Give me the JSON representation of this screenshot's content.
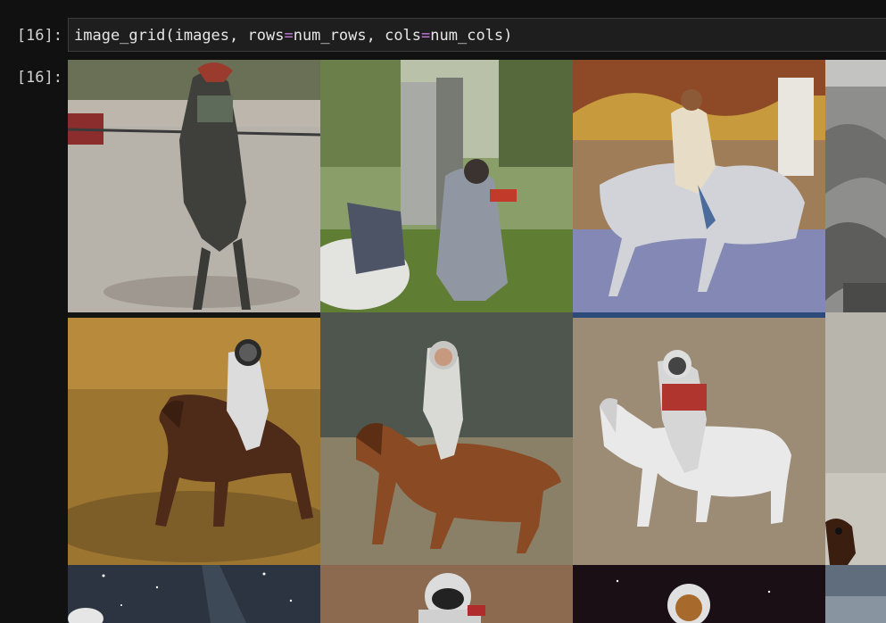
{
  "cell": {
    "input_prompt": "[16]:",
    "output_prompt": "[16]:",
    "code": {
      "fn": "image_grid",
      "open": "(",
      "arg1": "images, ",
      "kw1": "rows",
      "eq": "=",
      "val1": "num_rows",
      "sep": ", ",
      "kw2": "cols",
      "val2": "num_cols",
      "close": ")"
    }
  },
  "output": {
    "grid": {
      "tiles": [
        {
          "row": 0,
          "col": 0,
          "icon": "horse-creature-on-concrete"
        },
        {
          "row": 0,
          "col": 1,
          "icon": "astronaut-collage-forest"
        },
        {
          "row": 0,
          "col": 2,
          "icon": "woman-riding-white-horse-painting"
        },
        {
          "row": 0,
          "col": 3,
          "icon": "grey-rocky-texture"
        },
        {
          "row": 1,
          "col": 0,
          "icon": "astronaut-riding-horse-wheat-field"
        },
        {
          "row": 1,
          "col": 1,
          "icon": "astronaut-riding-brown-horse-painting"
        },
        {
          "row": 1,
          "col": 2,
          "icon": "astronaut-riding-white-horse-dirt"
        },
        {
          "row": 1,
          "col": 3,
          "icon": "partial-horse-head"
        },
        {
          "row": 2,
          "col": 0,
          "icon": "starry-night-sky"
        },
        {
          "row": 2,
          "col": 1,
          "icon": "astronaut-helmet-flag"
        },
        {
          "row": 2,
          "col": 2,
          "icon": "astronaut-in-space"
        },
        {
          "row": 2,
          "col": 3,
          "icon": "sky-horizon"
        }
      ]
    }
  }
}
